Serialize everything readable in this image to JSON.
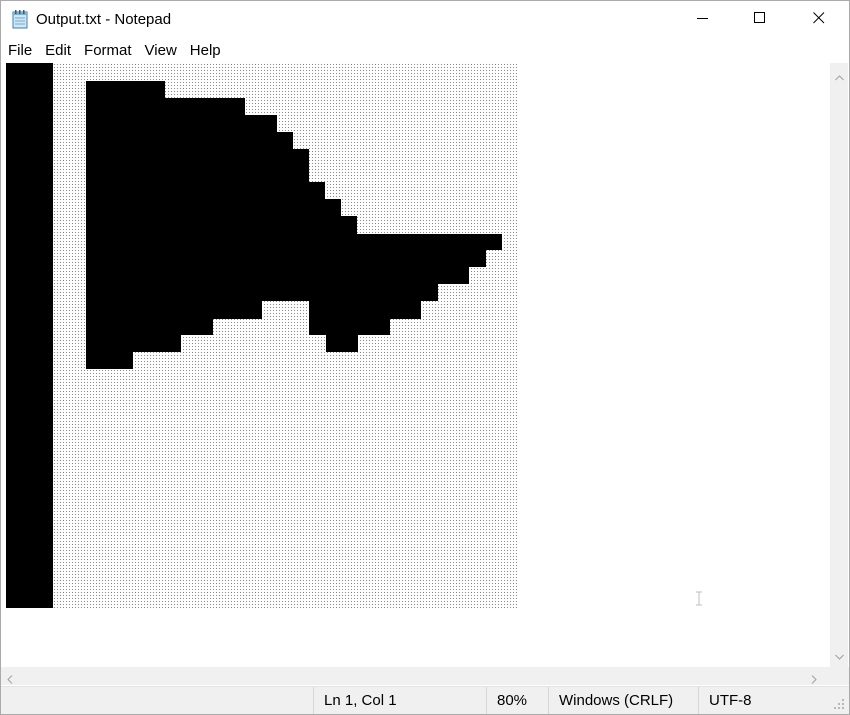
{
  "window": {
    "title": "Output.txt - Notepad"
  },
  "titlebar": {
    "app_icon": "notepad-icon",
    "controls": [
      "minimize-icon",
      "maximize-icon",
      "close-icon"
    ]
  },
  "menu": {
    "items": [
      "File",
      "Edit",
      "Format",
      "View",
      "Help"
    ]
  },
  "editor": {
    "content_description_icon": "ascii-art-flag",
    "cursor_icon": "ibeam-cursor-icon"
  },
  "statusbar": {
    "position": "Ln 1, Col 1",
    "zoom": "80%",
    "line_ending": "Windows (CRLF)",
    "encoding": "UTF-8"
  },
  "colors": {
    "ink": "#000000",
    "dots": "#8a8a8a",
    "chrome": "#f0f0f0"
  }
}
